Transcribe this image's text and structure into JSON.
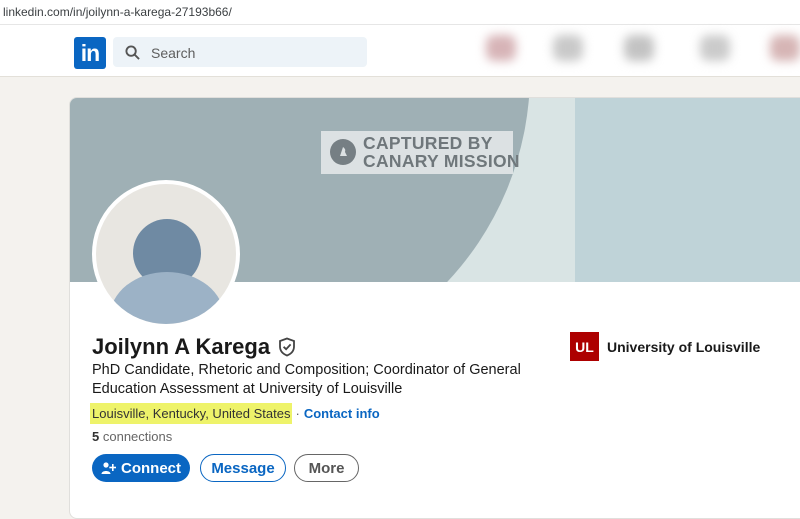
{
  "browser": {
    "url": "linkedin.com/in/joilynn-a-karega-27193b66/"
  },
  "nav": {
    "logo_text": "in",
    "search_placeholder": "Search",
    "icons": [
      "home-icon",
      "network-icon",
      "jobs-icon",
      "messaging-icon",
      "notifications-icon"
    ]
  },
  "banner": {
    "watermark_line1": "CAPTURED BY",
    "watermark_line2": "CANARY MISSION"
  },
  "profile": {
    "name": "Joilynn A Karega",
    "headline": "PhD Candidate, Rhetoric and Composition; Coordinator of General Education Assessment at University of Louisville",
    "location": "Louisville, Kentucky, United States",
    "separator": "·",
    "contact_info": "Contact info",
    "connections_count": "5",
    "connections_label": "connections"
  },
  "actions": {
    "connect": "Connect",
    "message": "Message",
    "more": "More"
  },
  "education": {
    "logo_text": "UL",
    "school": "University of Louisville"
  },
  "colors": {
    "linkedin_blue": "#0a66c2",
    "highlight": "#eef36a",
    "ul_red": "#ad0000"
  }
}
